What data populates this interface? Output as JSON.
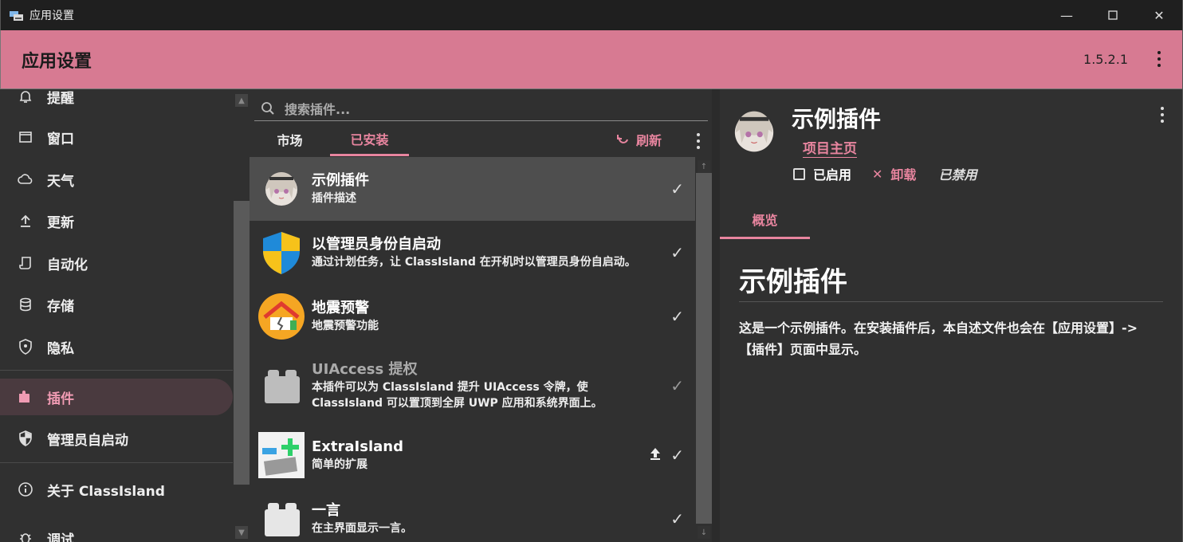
{
  "window": {
    "title": "应用设置",
    "minimize_icon": "minimize-icon",
    "maximize_icon": "maximize-icon",
    "close_icon": "close-icon"
  },
  "header": {
    "title": "应用设置",
    "version": "1.5.2.1",
    "accent": "#d77a92"
  },
  "sidebar": {
    "items": [
      {
        "label": "提醒",
        "icon": "bell-icon"
      },
      {
        "label": "窗口",
        "icon": "window-icon"
      },
      {
        "label": "天气",
        "icon": "cloud-icon"
      },
      {
        "label": "更新",
        "icon": "upload-icon"
      },
      {
        "label": "自动化",
        "icon": "script-icon"
      },
      {
        "label": "存储",
        "icon": "database-icon"
      },
      {
        "label": "隐私",
        "icon": "shield-icon"
      },
      {
        "label": "插件",
        "icon": "puzzle-icon",
        "active": true
      },
      {
        "label": "管理员自启动",
        "icon": "admin-shield-icon"
      },
      {
        "label": "关于 ClassIsland",
        "icon": "info-icon"
      },
      {
        "label": "调试",
        "icon": "bug-icon"
      }
    ]
  },
  "plugins": {
    "search_placeholder": "搜索插件...",
    "tabs": [
      "市场",
      "已安装"
    ],
    "active_tab": "已安装",
    "refresh_label": "刷新",
    "items": [
      {
        "name": "示例插件",
        "desc": "插件描述",
        "icon": "anime-avatar-icon"
      },
      {
        "name": "以管理员身份自启动",
        "desc": "通过计划任务，让 ClassIsland 在开机时以管理员身份自启动。",
        "icon": "uac-shield-icon"
      },
      {
        "name": "地震预警",
        "desc": "地震预警功能",
        "icon": "earthquake-house-icon"
      },
      {
        "name": "UIAccess 提权",
        "desc": "本插件可以为 ClassIsland 提升 UIAccess 令牌，使 ClassIsland 可以置顶到全屏 UWP 应用和系统界面上。",
        "icon": "puzzle-piece-icon"
      },
      {
        "name": "ExtraIsland",
        "desc": "简单的扩展",
        "icon": "extraisland-icon"
      },
      {
        "name": "一言",
        "desc": "在主界面显示一言。",
        "icon": "puzzle-piece-icon"
      }
    ]
  },
  "detail": {
    "title": "示例插件",
    "homepage_label": "项目主页",
    "enabled_label": "已启用",
    "uninstall_label": "卸载",
    "status_label": "已禁用",
    "tab_label": "概览",
    "readme_title": "示例插件",
    "readme_body": "这是一个示例插件。在安装插件后，本自述文件也会在【应用设置】->【插件】页面中显示。"
  }
}
